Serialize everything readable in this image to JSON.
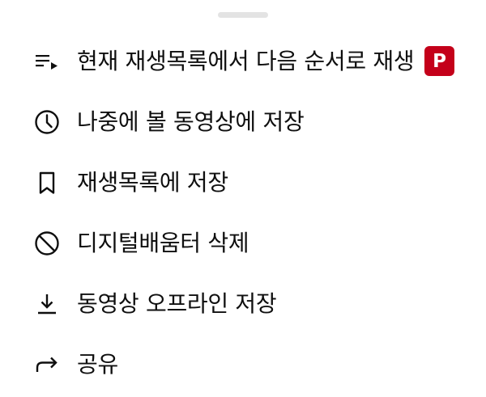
{
  "menu": {
    "items": [
      {
        "label": "현재 재생목록에서 다음 순서로 재생",
        "icon": "play-next-icon",
        "badge": "P"
      },
      {
        "label": "나중에 볼 동영상에 저장",
        "icon": "clock-icon"
      },
      {
        "label": "재생목록에 저장",
        "icon": "bookmark-icon"
      },
      {
        "label": "디지털배움터 삭제",
        "icon": "block-icon"
      },
      {
        "label": "동영상 오프라인 저장",
        "icon": "download-icon"
      },
      {
        "label": "공유",
        "icon": "share-icon"
      }
    ]
  },
  "colors": {
    "text": "#0f0f0f",
    "badge": "#c4001a",
    "handle": "#e3e3e3"
  }
}
